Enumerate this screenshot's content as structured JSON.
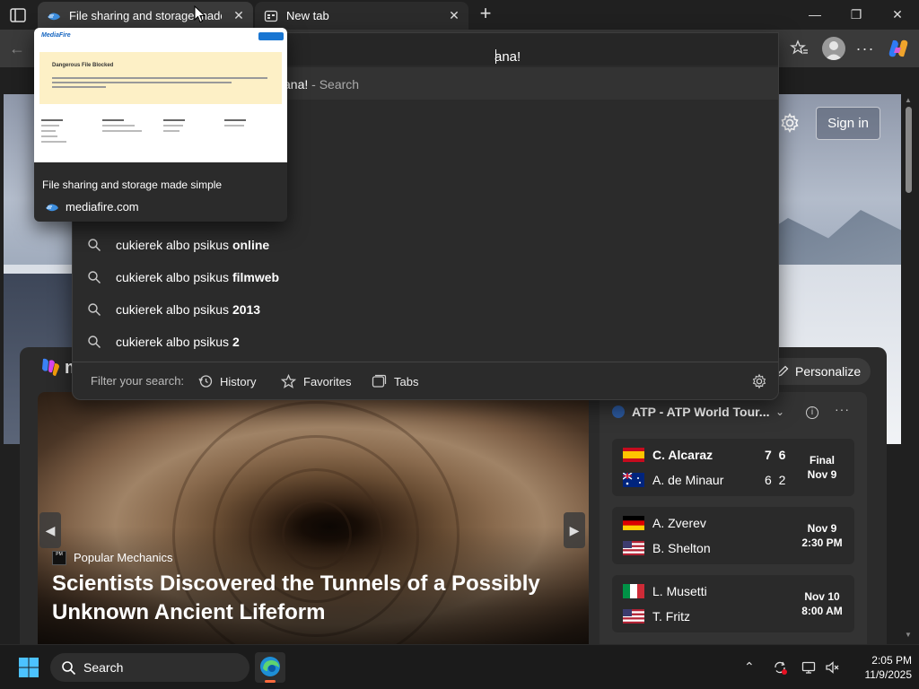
{
  "browser": {
    "tabs": [
      {
        "title": "File sharing and storage made simple",
        "active": true
      },
      {
        "title": "New tab",
        "active": false
      }
    ],
    "address": {
      "typed_visible": "ana!",
      "top_suggestion": "ana!",
      "top_suggestion_suffix": "- Search",
      "partial_1": "s",
      "partial_2": "e"
    },
    "suggestions": [
      {
        "prefix": "cukierek albo psikus ",
        "bold": "online"
      },
      {
        "prefix": "cukierek albo psikus ",
        "bold": "filmweb"
      },
      {
        "prefix": "cukierek albo psikus ",
        "bold": "2013"
      },
      {
        "prefix": "cukierek albo psikus ",
        "bold": "2"
      }
    ],
    "filter": {
      "label": "Filter your search:",
      "chips": [
        "History",
        "Favorites",
        "Tabs"
      ]
    }
  },
  "hovercard": {
    "title": "File sharing and storage made simple",
    "url": "mediafire.com",
    "thumb_logo": "MediaFire",
    "thumb_banner_title": "Dangerous File Blocked"
  },
  "page": {
    "sign_in": "Sign in",
    "personalize": "Personalize",
    "feed_letter": "m",
    "article": {
      "source": "Popular Mechanics",
      "headline": "Scientists Discovered the Tunnels of a Possibly Unknown Ancient Lifeform"
    },
    "sports": {
      "title": "ATP - ATP World Tour...",
      "matches": [
        {
          "p1": "C. Alcaraz",
          "p2": "A. de Minaur",
          "s1": "7 6",
          "s2": "6 2",
          "status": "Final",
          "date": "Nov 9",
          "p1_bold": true
        },
        {
          "p1": "A. Zverev",
          "p2": "B. Shelton",
          "s1": "",
          "s2": "",
          "status": "Nov 9",
          "date": "2:30 PM",
          "p1_bold": false
        },
        {
          "p1": "L. Musetti",
          "p2": "T. Fritz",
          "s1": "",
          "s2": "",
          "status": "Nov 10",
          "date": "8:00 AM",
          "p1_bold": false
        }
      ]
    }
  },
  "taskbar": {
    "search_label": "Search",
    "time": "2:05 PM",
    "date": "11/9/2025"
  },
  "colors": {
    "tab_active": "#3a3a3a",
    "dropdown_bg": "#2b2b2b",
    "edge_accent": "#ff6a3d",
    "mediafire_blue": "#1565c0"
  },
  "icons": {
    "tab_actions": "tab-actions-icon",
    "mediafire_favicon": "mediafire-logo-icon",
    "newtab_favicon": "newtab-icon",
    "search": "search-icon",
    "history": "history-icon",
    "favorites": "star-icon",
    "tabs": "tabs-icon",
    "settings": "gear-icon"
  }
}
